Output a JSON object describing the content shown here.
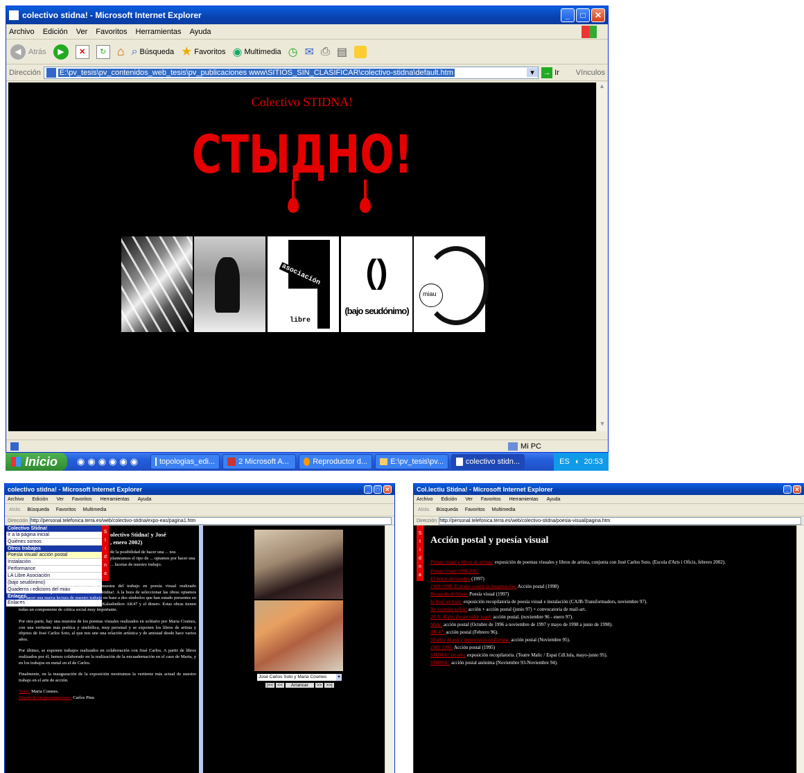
{
  "main": {
    "title": "colectivo stidna! - Microsoft Internet Explorer",
    "menu": [
      "Archivo",
      "Edición",
      "Ver",
      "Favoritos",
      "Herramientas",
      "Ayuda"
    ],
    "toolbar": {
      "back": "Atrás",
      "search": "Búsqueda",
      "favorites": "Favoritos",
      "multimedia": "Multimedia"
    },
    "address_label": "Dirección",
    "address": "E:\\pv_tesis\\pv_contenidos_web_tesis\\pv_publicaciones www\\SITIOS_SIN_CLASIFICAR\\colectivo-stidna\\default.htm",
    "go": "Ir",
    "links": "Vínculos",
    "heading": "Colectivo STIDNA!",
    "logo": "СТЫДНО!",
    "tile_asoc_1": "asociación",
    "tile_asoc_2": "libre",
    "tile_paren": "()",
    "tile_pseudo": "(bajo seudónimo)",
    "tile_miau": "miau",
    "status_zone": "Mi PC"
  },
  "taskbar": {
    "start": "Inicio",
    "tasks": [
      "topologias_edi...",
      "2 Microsoft A...",
      "Reproductor d...",
      "E:\\pv_tesis\\pv...",
      "colectivo stidn..."
    ],
    "lang": "ES",
    "clock": "20:53"
  },
  "left": {
    "title": "colectivo stidna! - Microsoft Internet Explorer",
    "address": "http://personal.telefonica.terra.es/web/colectivo-stidna/expo-eas/pagina1.htm",
    "nav": {
      "head1": "Colectivo Stidna!",
      "items1": [
        "Ir a la página inicial",
        "Quiénes somos"
      ],
      "head2": "Otros trabajos",
      "items2": [
        "Poesía visual/ acción postal",
        "Instalación",
        "Performance",
        "LA Libre Asociación",
        "(bajo seudónimo)",
        "Quaderns i edicions del miau"
      ],
      "head3": "Enlaces",
      "items3": [
        "Enlaces"
      ]
    },
    "heading_1": "olectivo Stidna! y José",
    "heading_2": ", enero 2002)",
    "intro": "de la posibilidad de hacer una ... nos planteamos el tipo de ... optamos por hacer una ... facetas de nuestro trabajo.",
    "p1": "Podemos encontrar por una parte una muestra del trabajo en poesía visual realizado conjuntamente bajo el nombre de Colectivo Stidna!. A la hora de seleccionar las obras optamos por hacer una nueva lectura de nuestro trabajo en base a dos símbolos que han estado presentes en muchas de nuestras obras: el fusil de asalto Kalashnikov AK47 y el dinero. Estas obras tienen todas un componente de crítica social muy importante.",
    "p2": "Por otra parte, hay una muestra de los poemas visuales realizados en solitario por Maria Cosmes, con una vertiente más poética y simbólica, muy personal y se exponen los libros de artista y objetos de José Carlos Soto, al que nos une una relación artística y de amistad desde hace varios años.",
    "p3": "Por último, se exponen trabajos realizados en colaboración con José Carlos. A partir de libros realizados por él, hemos colaborado en la realización de la encuadernación en el caso de Maria, y en los trabajos en metal en el de Carlos.",
    "p4": "Finalmente, en la inauguración de la exposición mostramos la vertiente más actual de nuestro trabajo en el arte de acción.",
    "credit1_link": "Texto:",
    "credit1": "Maria Cosmes.",
    "credit2_link": "Diseño de las presentaciones:",
    "credit2": "Carlos Pina.",
    "select": "José Carlos Soto y Maria Cosmes",
    "start_btn": "Arrancar",
    "nav_first": "|<<",
    "nav_prev": "<<",
    "nav_next": ">>",
    "nav_last": ">>|"
  },
  "right": {
    "title": "Col.lectiu Stidna! - Microsoft Internet Explorer",
    "address": "http://personal.telefonica.terra.es/web/colectivo-stidna/poesia-visual/pagina.htm",
    "heading": "Acción postal y poesía visual",
    "items": [
      {
        "link": "Poesía visual y libros de artista:",
        "text": " exposición de poemas visuales y libros de artista, conjunta con José Carlos Soto. (Escola d'Arts i Oficis, febrero 2002)."
      },
      {
        "link": "Poesía visual 1998-2001",
        "text": ""
      },
      {
        "link": "El motor del cambio",
        "text": " (1997)"
      },
      {
        "link": "1968-1998. El poder contra la imaginación:",
        "text": " Acción postal (1998)"
      },
      {
        "link": "Recuerdo de Sónia.",
        "text": " Poesía visual (1997)"
      },
      {
        "link": "In God we trust:",
        "text": " exposición recopilatoria de poesía visual e instalación (CAJB-Transformadors, noviembre 97)."
      },
      {
        "link": "No necesita sellos:",
        "text": " acción + acción postal (junio 97) + convocatoria de mail-art."
      },
      {
        "link": "20-N. Al-fin, fin sin valor legal:",
        "text": " acción postal. (noviembre 96 - enero 97)."
      },
      {
        "link": "Malu:",
        "text": " acción postal (Octubre de 1996 a noviembre de 1997 y mayo de 1998 a junio de 1998)."
      },
      {
        "link": "AK-47:",
        "text": " acción postal (Febrero 96)."
      },
      {
        "link": "50 años de paz y democracia en Europa:",
        "text": " acción postal (Noviembre 95)."
      },
      {
        "link": "1981-1995:",
        "text": " Acción postal (1995)"
      },
      {
        "link": "STIDNA!, un año:",
        "text": " exposición recopilatoria. (Teatre Malic / Espai Cdl.lula, mayo-junio 95)."
      },
      {
        "link": "STIDNA!:",
        "text": " acción postal anónima (Noviembre 93-Noviembre 94)."
      }
    ]
  },
  "stidna_letters": [
    "S",
    "t",
    "i",
    "d",
    "n",
    "a"
  ],
  "colors": {
    "accent_red": "#e40000",
    "bg": "#000000",
    "xp_blue": "#0842b0"
  }
}
